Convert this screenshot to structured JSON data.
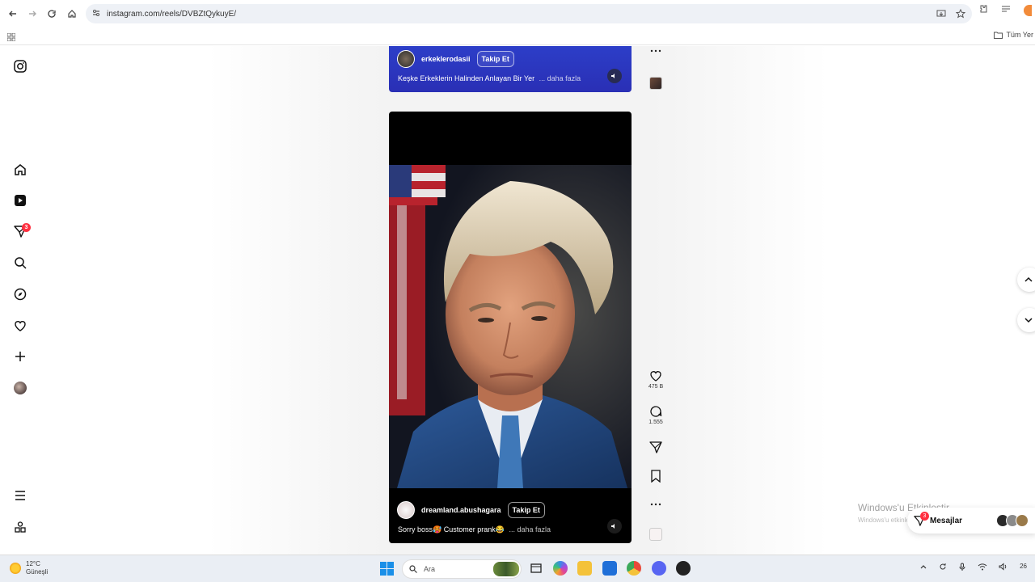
{
  "browser": {
    "url": "instagram.com/reels/DVBZtQykuyE/",
    "bookmarks_folder": "Tüm Yer"
  },
  "sidebar": {
    "notification_count": "3"
  },
  "reels": [
    {
      "owner": "erkeklerodasii",
      "follow_label": "Takip Et",
      "caption": "Keşke Erkeklerin Halinden Anlayan Bir Yer",
      "more_label": "... daha fazla"
    },
    {
      "owner": "dreamland.abushagara",
      "follow_label": "Takip Et",
      "caption": "Sorry boss🥵 Customer prank😂",
      "more_label": "... daha fazla",
      "likes": "475 B",
      "comments": "1.555"
    }
  ],
  "overlay": {
    "activate_title": "Windows'u Etkinleştir",
    "activate_subtitle": "Windows'u etkinleştirmek için Ayarlar'a gidin.",
    "messages_label": "Mesajlar",
    "messages_count": "3"
  },
  "taskbar": {
    "temperature": "12°C",
    "weather": "Güneşli",
    "search_placeholder": "Ara",
    "clock": "26"
  },
  "colors": {
    "reel_top_bg": "#2c3ec8",
    "badge": "#ff3040",
    "windows_blue": "#1a8fe8"
  }
}
